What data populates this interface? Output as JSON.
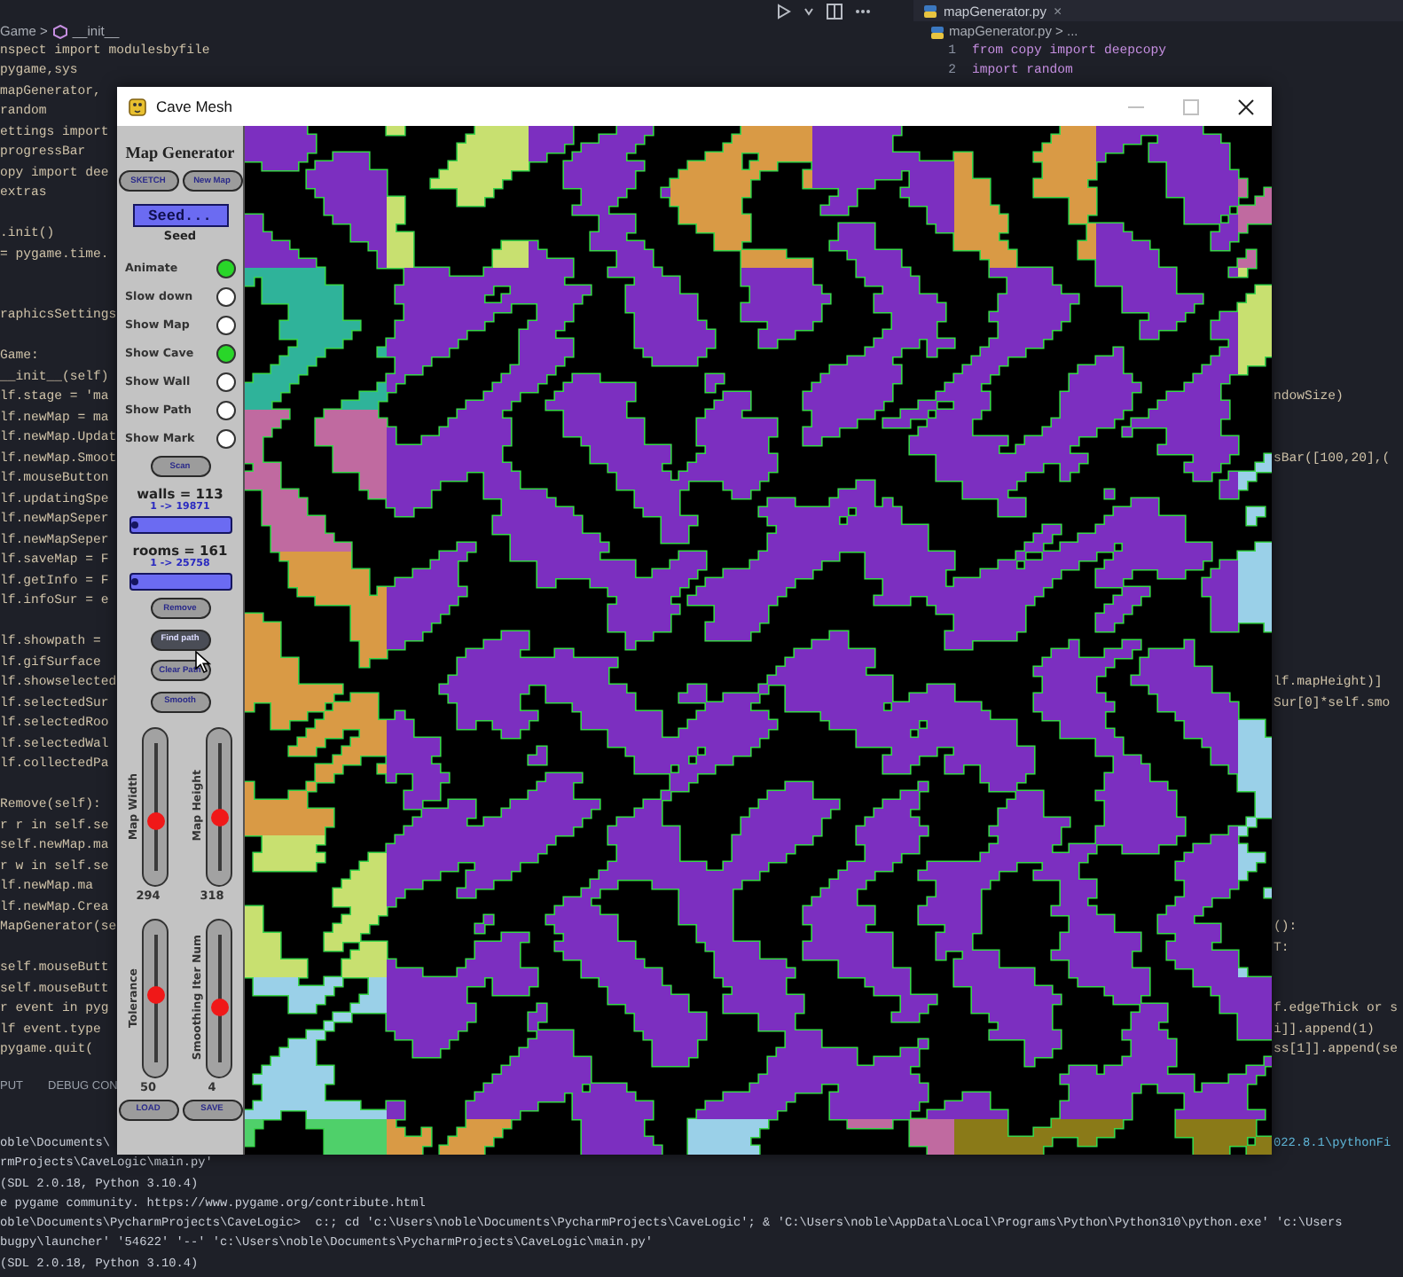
{
  "editor": {
    "left_breadcrumb": {
      "parent": "Game >",
      "child": "__init__"
    },
    "left_blocks": [
      [
        "nspect import modulesbyfile",
        "pygame,sys",
        "mapGenerator,",
        "random",
        "ettings import",
        "progressBar",
        "opy import dee",
        "extras"
      ],
      [
        ".init()",
        "= pygame.time."
      ],
      [
        "raphicsSettings"
      ],
      [
        "Game:",
        "__init__(self)",
        "lf.stage = 'ma",
        "lf.newMap = ma",
        "lf.newMap.Updat",
        "lf.newMap.Smoot",
        "lf.mouseButton",
        "lf.updatingSpe",
        "lf.newMapSeper",
        "lf.newMapSeper",
        "lf.saveMap = F",
        "lf.getInfo = F",
        "lf.infoSur = e"
      ],
      [
        "lf.showpath = ",
        "lf.gifSurface ",
        "lf.showselected",
        "lf.selectedSur",
        "lf.selectedRoo",
        "lf.selectedWal",
        "lf.collectedPa"
      ],
      [
        "Remove(self):",
        "r r in self.se",
        "self.newMap.ma",
        "r w in self.se",
        "lf.newMap.ma",
        "lf.newMap.Crea",
        "MapGenerator(se"
      ],
      [
        "self.mouseButt",
        "self.mouseButt",
        "r event in pyg",
        "lf event.type",
        "pygame.quit("
      ]
    ],
    "tab": {
      "label": "mapGenerator.py",
      "close": "×",
      "selected": true
    },
    "right_breadcrumb": "mapGenerator.py > ...",
    "right_numbered_lines": [
      {
        "number": "1",
        "text": "from copy import deepcopy"
      },
      {
        "number": "2",
        "text": "import random"
      }
    ],
    "right_tail_blocks": [
      [
        "ndowSize)"
      ],
      [
        "sBar([100,20],("
      ],
      [
        "lf.mapHeight)]",
        "Sur[0]*self.smo"
      ],
      [
        "():",
        "T:"
      ],
      [
        "f.edgeThick or s",
        "i]].append(1)",
        "ss[1]].append(se"
      ]
    ],
    "panel_tabs": [
      "PUT",
      "DEBUG CON"
    ],
    "terminal_lines": [
      {
        "left": "oble\\Documents\\",
        "right": "022.8.1\\pythonFi"
      },
      {
        "left": "rmProjects\\CaveLogic\\main.py'"
      },
      {
        "left": "(SDL 2.0.18, Python 3.10.4)"
      },
      {
        "left": "e pygame community. https://www.pygame.org/contribute.html"
      },
      {
        "left": "oble\\Documents\\PycharmProjects\\CaveLogic>  c:; cd 'c:\\Users\\noble\\Documents\\PycharmProjects\\CaveLogic'; & 'C:\\Users\\noble\\AppData\\Local\\Programs\\Python\\Python310\\python.exe' 'c:\\Users"
      },
      {
        "left": "bugpy\\launcher' '54622' '--' 'c:\\Users\\noble\\Documents\\PycharmProjects\\CaveLogic\\main.py'"
      },
      {
        "left": "(SDL 2.0.18, Python 3.10.4)"
      }
    ]
  },
  "window": {
    "title": "Cave Mesh",
    "panel": {
      "title": "Map Generator",
      "top_buttons": [
        {
          "label": "SKETCH",
          "hovered": false
        },
        {
          "label": "New Map",
          "hovered": false
        }
      ],
      "seed": {
        "value": "Seed...",
        "label": "Seed"
      },
      "toggles": [
        {
          "label": "Animate",
          "checked": true
        },
        {
          "label": "Slow down",
          "checked": false
        },
        {
          "label": "Show Map",
          "checked": false
        },
        {
          "label": "Show Cave",
          "checked": true
        },
        {
          "label": "Show Wall",
          "checked": false
        },
        {
          "label": "Show Path",
          "checked": false
        },
        {
          "label": "Show Mark",
          "checked": false
        }
      ],
      "scan_button": {
        "label": "Scan",
        "hovered": false
      },
      "stats": [
        {
          "title": "walls = 113",
          "range": "1 -> 19871",
          "level": 0.05
        },
        {
          "title": "rooms = 161",
          "range": "1 -> 25758",
          "level": 0.05
        }
      ],
      "buttons": [
        {
          "label": "Remove",
          "hovered": false
        },
        {
          "label": "Find path",
          "hovered": true
        },
        {
          "label": "Clear Path",
          "hovered": false
        },
        {
          "label": "Smooth",
          "hovered": false
        }
      ],
      "sliders": [
        {
          "label": "Map Width",
          "value": "294",
          "level": 0.4
        },
        {
          "label": "Map Height",
          "value": "318",
          "level": 0.43
        },
        {
          "label": "Tolerance",
          "value": "50",
          "level": 0.52
        },
        {
          "label": "Smoothing Iter Num",
          "value": "4",
          "level": 0.44
        }
      ],
      "bottom_buttons": [
        {
          "label": "LOAD",
          "hovered": false
        },
        {
          "label": "SAVE",
          "hovered": false
        }
      ]
    }
  }
}
